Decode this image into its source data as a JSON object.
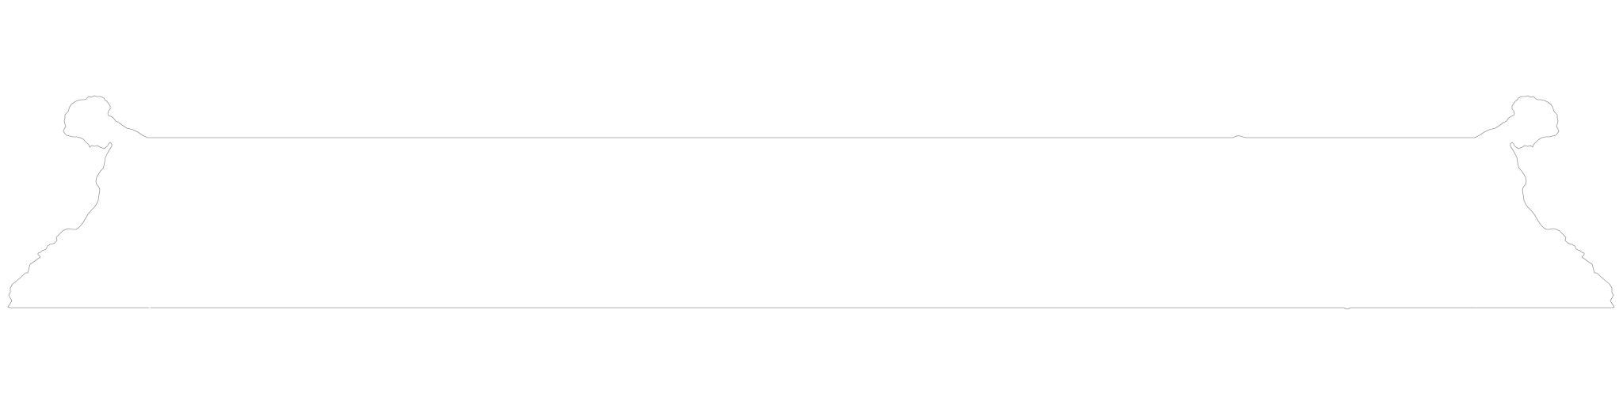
{
  "figure": {
    "subject": "cabinet-silhouette-outline",
    "background_color": "#ffffff",
    "stroke_color": "#9a9a9a"
  }
}
